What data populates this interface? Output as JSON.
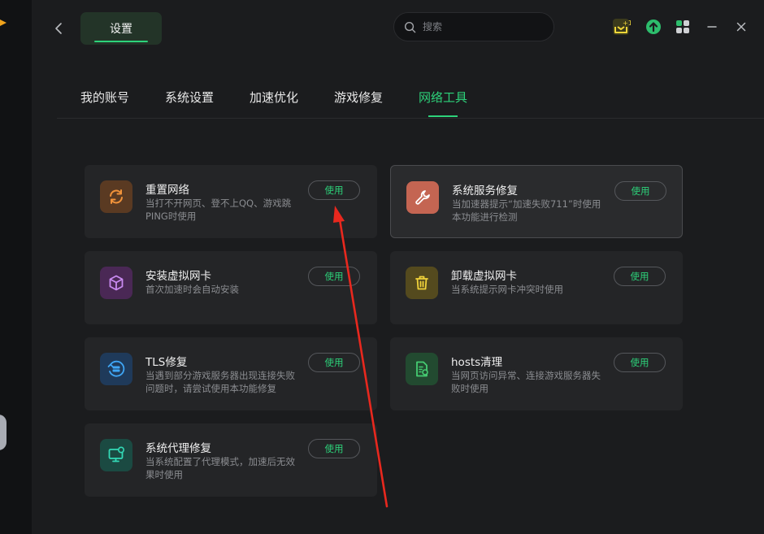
{
  "header": {
    "settings_tab": "设置",
    "search_placeholder": "搜索"
  },
  "nav": {
    "tabs": [
      {
        "label": "我的账号"
      },
      {
        "label": "系统设置"
      },
      {
        "label": "加速优化"
      },
      {
        "label": "游戏修复"
      },
      {
        "label": "网络工具"
      }
    ],
    "active": "网络工具"
  },
  "tools": [
    {
      "title": "重置网络",
      "desc": "当打不开网页、登不上QQ、游戏跳PING时使用",
      "button": "使用",
      "icon": "refresh-icon",
      "color": "#e8872c"
    },
    {
      "title": "系统服务修复",
      "desc": "当加速器提示“加速失败711”时使用本功能进行检测",
      "button": "使用",
      "icon": "wrench-icon",
      "color": "#ee8a72"
    },
    {
      "title": "安装虚拟网卡",
      "desc": "首次加速时会自动安装",
      "button": "使用",
      "icon": "cube-icon",
      "color": "#c27be8"
    },
    {
      "title": "卸载虚拟网卡",
      "desc": "当系统提示网卡冲突时使用",
      "button": "使用",
      "icon": "trash-icon",
      "color": "#e8cd2c"
    },
    {
      "title": "TLS修复",
      "desc": "当遇到部分游戏服务器出现连接失败问题时，请尝试使用本功能修复",
      "button": "使用",
      "icon": "tls-icon",
      "color": "#3a9ef0"
    },
    {
      "title": "hosts清理",
      "desc": "当网页访问异常、连接游戏服务器失败时使用",
      "button": "使用",
      "icon": "file-icon",
      "color": "#3cc86a"
    },
    {
      "title": "系统代理修复",
      "desc": "当系统配置了代理模式，加速后无效果时使用",
      "button": "使用",
      "icon": "monitor-icon",
      "color": "#2fd6b5"
    }
  ],
  "colors": {
    "accent": "#2dd27a",
    "background": "#1b1c1e",
    "card": "#242527"
  }
}
